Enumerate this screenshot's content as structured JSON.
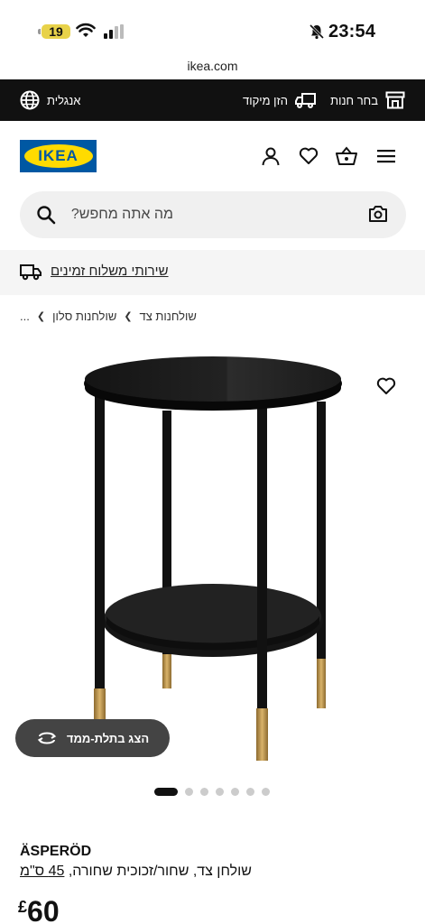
{
  "status_bar": {
    "battery": "19",
    "time": "23:54"
  },
  "url": "ikea.com",
  "top_bar": {
    "choose_store": "בחר חנות",
    "postal_code": "הזן מיקוד",
    "language": "אנגלית"
  },
  "search": {
    "placeholder": "מה אתה מחפש?"
  },
  "banner": {
    "text": "שירותי משלוח זמינים"
  },
  "breadcrumb": [
    "שולחנות צד",
    "שולחנות סלון",
    "..."
  ],
  "product": {
    "view_3d": "הצג בתלת-ממד",
    "carousel": {
      "count": 7,
      "active": 1
    },
    "name": "ÄSPERÖD",
    "description": "שולחן צד, שחור/זכוכית שחורה,",
    "size": "45 ס\"מ",
    "currency": "£",
    "price": "60"
  },
  "icons": {
    "wifi": "wifi-icon",
    "signal": "signal-icon",
    "mute": "bell-off-icon",
    "store": "store-icon",
    "truck": "truck-icon",
    "globe": "globe-icon",
    "user": "user-icon",
    "heart": "heart-icon",
    "cart": "basket-icon",
    "menu": "menu-icon",
    "search": "search-icon",
    "camera": "camera-icon",
    "rotate": "rotate-3d-icon"
  },
  "colors": {
    "brand_blue": "#0058a3",
    "brand_yellow": "#ffdb00",
    "top_bar": "#111111"
  }
}
